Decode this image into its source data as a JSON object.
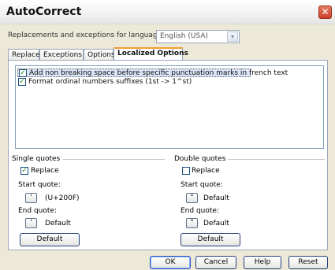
{
  "window": {
    "title": "AutoCorrect",
    "close_glyph": "✕"
  },
  "language": {
    "label": "Replacements and exceptions for language:",
    "selected": "English (USA)",
    "arrow_glyph": "▾"
  },
  "tabs": [
    {
      "label": "Replace"
    },
    {
      "label": "Exceptions"
    },
    {
      "label": "Options"
    },
    {
      "label": "Localized Options"
    }
  ],
  "options": [
    {
      "label": "Add non breaking space before specific punctuation marks in french text",
      "checked": true
    },
    {
      "label": "Format ordinal numbers suffixes (1st -> 1^st)",
      "checked": true
    }
  ],
  "single_quotes": {
    "title": "Single quotes",
    "replace_label": "Replace",
    "replace_checked": true,
    "start_label": "Start quote:",
    "start_glyph": "'",
    "start_value": "(U+200F)",
    "end_label": "End quote:",
    "end_glyph": "'",
    "end_value": "Default",
    "default_button": "Default"
  },
  "double_quotes": {
    "title": "Double quotes",
    "replace_label": "Replace",
    "replace_checked": false,
    "start_label": "Start quote:",
    "start_glyph": "\"",
    "start_value": "Default",
    "end_label": "End quote:",
    "end_glyph": "\"",
    "end_value": "Default",
    "default_button": "Default"
  },
  "buttons": {
    "ok": "OK",
    "cancel": "Cancel",
    "help": "Help",
    "reset": "Reset"
  },
  "check_glyph": "✓"
}
